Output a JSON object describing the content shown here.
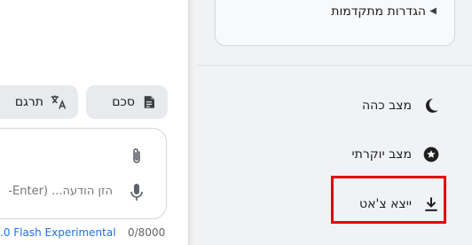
{
  "toolbar": {
    "summarize_label": "סכם",
    "translate_label": "תרגם"
  },
  "composer": {
    "placeholder": "הזן הודעה... (Enter-",
    "model_label": ".0 Flash Experimental",
    "char_count": "0/8000"
  },
  "settings": {
    "advanced_label": "הגדרות מתקדמות",
    "menu": {
      "dark_mode": "מצב כהה",
      "bright_mode": "מצב יוקרתי",
      "export_chat": "ייצא צ'אט"
    }
  },
  "icons": {
    "summarize": "document-icon",
    "translate": "translate-icon",
    "attach": "paperclip-icon",
    "mic": "microphone-icon",
    "dark": "moon-icon",
    "bright": "star-circle-icon",
    "export": "download-icon",
    "advanced": "caret-left-icon"
  },
  "colors": {
    "accent": "#1a73e8",
    "highlight": "#e3000f",
    "panel_bg": "#f0f2f5",
    "chip_bg": "#e8eaed"
  }
}
